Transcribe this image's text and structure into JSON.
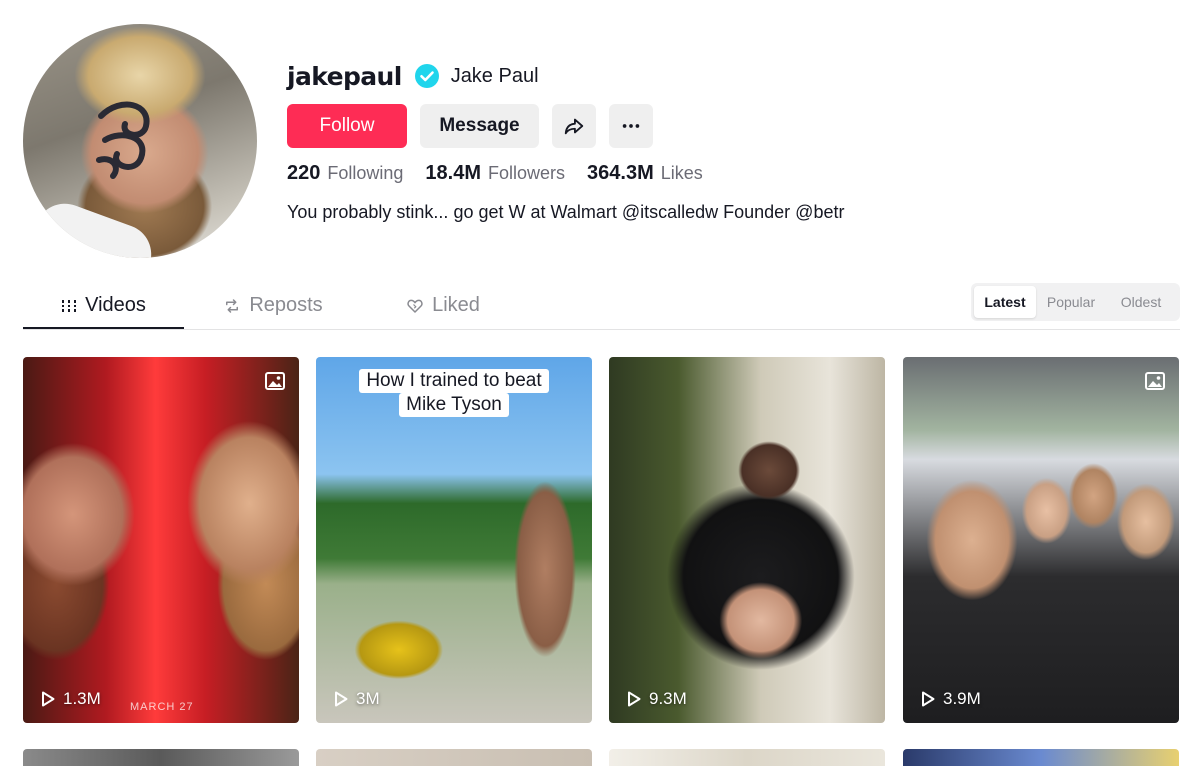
{
  "profile": {
    "username": "jakepaul",
    "display_name": "Jake Paul",
    "verified": true,
    "bio": "You probably stink... go get W at Walmart @itscalledw Founder @betr"
  },
  "actions": {
    "follow_label": "Follow",
    "message_label": "Message",
    "share_icon": "share-icon",
    "more_icon": "more-icon"
  },
  "stats": {
    "following_count": "220",
    "following_label": "Following",
    "followers_count": "18.4M",
    "followers_label": "Followers",
    "likes_count": "364.3M",
    "likes_label": "Likes"
  },
  "tabs": [
    {
      "label": "Videos",
      "icon": "grid-icon",
      "active": true
    },
    {
      "label": "Reposts",
      "icon": "repost-icon",
      "active": false
    },
    {
      "label": "Liked",
      "icon": "heart-icon",
      "active": false
    }
  ],
  "sort": {
    "options": [
      "Latest",
      "Popular",
      "Oldest"
    ],
    "selected": "Latest"
  },
  "videos": [
    {
      "views": "1.3M",
      "photo_post": true,
      "watermark": "MARCH 27"
    },
    {
      "views": "3M",
      "photo_post": false,
      "caption_line1": "How I trained to beat",
      "caption_line2": "Mike Tyson"
    },
    {
      "views": "9.3M",
      "photo_post": false
    },
    {
      "views": "3.9M",
      "photo_post": true
    }
  ],
  "colors": {
    "follow_button": "#fe2c55",
    "verified_badge": "#20d5ec",
    "secondary_button": "#efefef",
    "text_primary": "#161823",
    "text_secondary": "#6b6b75"
  }
}
